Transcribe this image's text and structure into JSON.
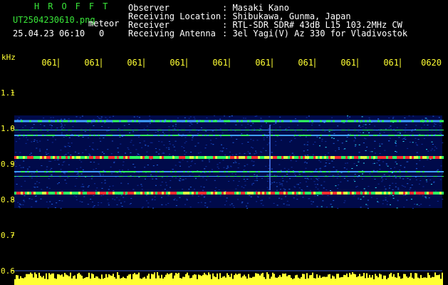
{
  "header": {
    "app_title": "HROFFT",
    "filename": "UT2504230610.png",
    "mode_label": "meteor",
    "datetime": "25.04.23 06:10",
    "count": "0"
  },
  "info": {
    "rows": [
      {
        "key": "Observer",
        "value": ": Masaki Kano"
      },
      {
        "key": "Receiving Location",
        "value": ": Shibukawa, Gunma, Japan"
      },
      {
        "key": "Receiver",
        "value": ": RTL-SDR SDR# 43dB L15 103.2MHz CW"
      },
      {
        "key": "Receiving Antenna",
        "value": ": 3el Yagi(V) Az 330 for Vladivostok"
      }
    ]
  },
  "axis": {
    "y_unit": "kHz",
    "y_ticks": [
      "1.1",
      "1.0",
      "0.9",
      "0.8",
      "0.7",
      "0.6"
    ],
    "x_ticks": [
      "0611",
      "0612",
      "0613",
      "0614",
      "0615",
      "0616",
      "0617",
      "0618",
      "0619",
      "0620"
    ]
  },
  "colors": {
    "background": "#000000",
    "spectrogram_bg": "#000a4a",
    "header_green": "#39e639",
    "axis_yellow": "#ffff33",
    "signal_hot": "#ff3030",
    "signal_mid": "#30ff60",
    "signal_cool": "#40a0ff"
  }
}
